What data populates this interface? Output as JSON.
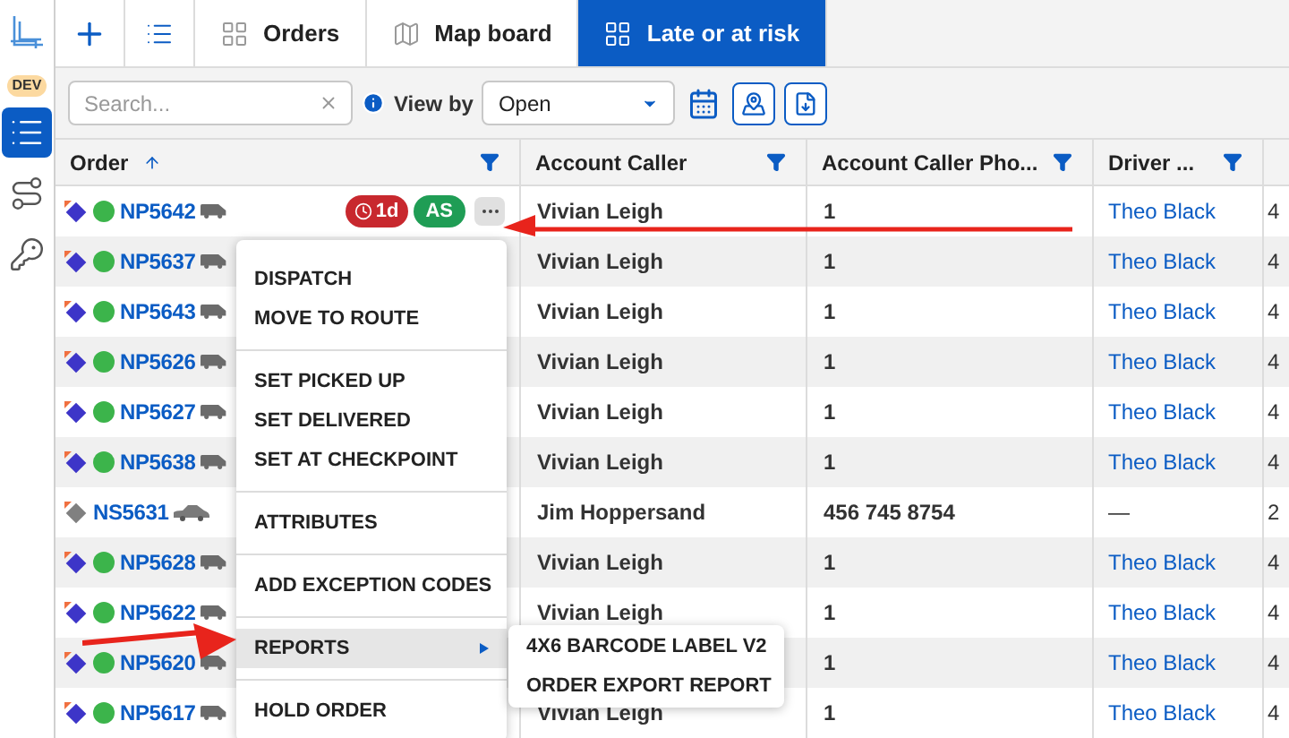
{
  "sidebar": {
    "badge": "DEV",
    "items": [
      {
        "kind": "list",
        "selected": true
      },
      {
        "kind": "route",
        "selected": false
      },
      {
        "kind": "key",
        "selected": false
      }
    ]
  },
  "tabs": [
    {
      "kind": "add",
      "selected": false
    },
    {
      "kind": "list",
      "selected": false
    },
    {
      "kind": "grid",
      "label": "Orders",
      "selected": false
    },
    {
      "kind": "map",
      "label": "Map board",
      "selected": false
    },
    {
      "kind": "grid",
      "label": "Late or at risk",
      "selected": true
    }
  ],
  "toolbar": {
    "search": {
      "placeholder": "Search..."
    },
    "view_by_label": "View by",
    "view_by_value": "Open"
  },
  "table": {
    "columns": [
      {
        "label": "Order",
        "sortable": true,
        "filter": true
      },
      {
        "label": "Account Caller",
        "sortable": false,
        "filter": true
      },
      {
        "label": "Account Caller Pho...",
        "sortable": false,
        "filter": true
      },
      {
        "label": "Driver ...",
        "sortable": false,
        "filter": true
      }
    ],
    "rows": [
      {
        "order": "NP5642",
        "color": "#3d35c8",
        "status_icon": true,
        "kind": "van",
        "badges": [
          {
            "kind": "late",
            "text": "1d"
          },
          {
            "kind": "initials",
            "text": "AS"
          }
        ],
        "more": true,
        "caller": "Vivian Leigh",
        "phone": "1",
        "driver": "Theo Black",
        "driver_link": true,
        "column_5": "4"
      },
      {
        "order": "NP5637",
        "color": "#3d35c8",
        "status_icon": true,
        "kind": "van",
        "caller": "Vivian Leigh",
        "phone": "1",
        "driver": "Theo Black",
        "driver_link": true,
        "column_5": "4"
      },
      {
        "order": "NP5643",
        "color": "#3d35c8",
        "status_icon": true,
        "kind": "van",
        "caller": "Vivian Leigh",
        "phone": "1",
        "driver": "Theo Black",
        "driver_link": true,
        "column_5": "4"
      },
      {
        "order": "NP5626",
        "color": "#3d35c8",
        "status_icon": true,
        "kind": "van",
        "caller": "Vivian Leigh",
        "phone": "1",
        "driver": "Theo Black",
        "driver_link": true,
        "column_5": "4"
      },
      {
        "order": "NP5627",
        "color": "#3d35c8",
        "status_icon": true,
        "kind": "van",
        "caller": "Vivian Leigh",
        "phone": "1",
        "driver": "Theo Black",
        "driver_link": true,
        "column_5": "4"
      },
      {
        "order": "NP5638",
        "color": "#3d35c8",
        "status_icon": true,
        "kind": "van",
        "caller": "Vivian Leigh",
        "phone": "1",
        "driver": "Theo Black",
        "driver_link": true,
        "column_5": "4"
      },
      {
        "order": "NS5631",
        "color": "#808080",
        "status_icon": false,
        "kind": "car",
        "caller": "Jim Hoppersand",
        "phone": "456 745 8754",
        "driver": "—",
        "driver_link": false,
        "column_5": "2"
      },
      {
        "order": "NP5628",
        "color": "#3d35c8",
        "status_icon": true,
        "kind": "van",
        "caller": "Vivian Leigh",
        "phone": "1",
        "driver": "Theo Black",
        "driver_link": true,
        "column_5": "4"
      },
      {
        "order": "NP5622",
        "color": "#3d35c8",
        "status_icon": true,
        "kind": "van",
        "caller": "Vivian Leigh",
        "phone": "1",
        "driver": "Theo Black",
        "driver_link": true,
        "column_5": "4"
      },
      {
        "order": "NP5620",
        "color": "#3d35c8",
        "status_icon": true,
        "kind": "van",
        "phone": "1",
        "driver": "Theo Black",
        "driver_link": true,
        "column_5": "4"
      },
      {
        "order": "NP5617",
        "color": "#3d35c8",
        "status_icon": true,
        "kind": "van",
        "caller": "Vivian Leigh",
        "phone": "1",
        "driver": "Theo Black",
        "driver_link": true,
        "column_5": "4"
      }
    ]
  },
  "context_menu": {
    "groups": [
      [
        {
          "label": "DISPATCH",
          "selected": false,
          "submenu": false
        },
        {
          "label": "MOVE TO ROUTE",
          "selected": false,
          "submenu": false
        }
      ],
      [
        {
          "label": "SET PICKED UP",
          "selected": false,
          "submenu": false
        },
        {
          "label": "SET DELIVERED",
          "selected": false,
          "submenu": false
        },
        {
          "label": "SET AT CHECKPOINT",
          "selected": false,
          "submenu": false
        }
      ],
      [
        {
          "label": "ATTRIBUTES",
          "selected": false,
          "submenu": false
        }
      ],
      [
        {
          "label": "ADD EXCEPTION CODES",
          "selected": false,
          "submenu": false
        }
      ],
      [
        {
          "label": "REPORTS",
          "selected": true,
          "submenu": true
        }
      ],
      [
        {
          "label": "HOLD ORDER",
          "selected": false,
          "submenu": false
        }
      ]
    ],
    "submenu": [
      {
        "label": "4X6 BARCODE LABEL V2"
      },
      {
        "label": "ORDER EXPORT REPORT"
      }
    ]
  }
}
